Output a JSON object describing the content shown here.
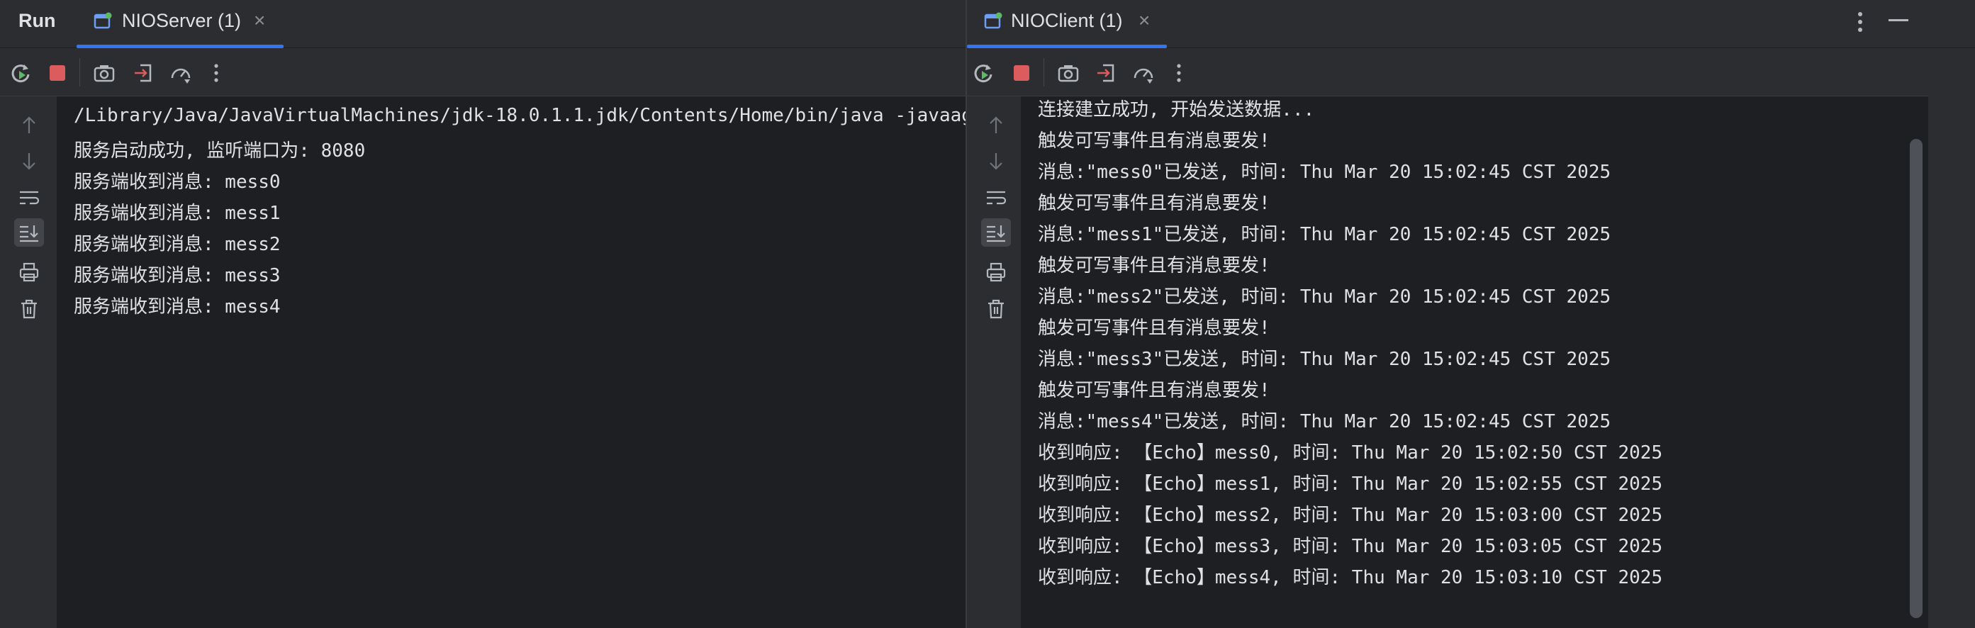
{
  "run_label": "Run",
  "tabs": [
    {
      "title": "NIOServer (1)"
    },
    {
      "title": "NIOClient (1)"
    }
  ],
  "icons": {
    "rerun": "rerun-icon",
    "stop": "stop-icon",
    "screenshot": "camera-icon",
    "exit": "exit-icon",
    "profile": "gauge-icon",
    "more": "more-vertical-icon",
    "up": "arrow-up-icon",
    "down": "arrow-down-icon",
    "wrap": "soft-wrap-icon",
    "scroll_end": "scroll-to-end-icon",
    "print": "print-icon",
    "trash": "trash-icon",
    "minimize": "minimize-icon"
  },
  "server_console": [
    "/Library/Java/JavaVirtualMachines/jdk-18.0.1.1.jdk/Contents/Home/bin/java -javaag",
    "服务启动成功, 监听端口为: 8080",
    "服务端收到消息: mess0",
    "服务端收到消息: mess1",
    "服务端收到消息: mess2",
    "服务端收到消息: mess3",
    "服务端收到消息: mess4"
  ],
  "client_console": [
    "连接建立成功, 开始发送数据...",
    "触发可写事件且有消息要发!",
    "消息:\"mess0\"已发送, 时间: Thu Mar 20 15:02:45 CST 2025",
    "触发可写事件且有消息要发!",
    "消息:\"mess1\"已发送, 时间: Thu Mar 20 15:02:45 CST 2025",
    "触发可写事件且有消息要发!",
    "消息:\"mess2\"已发送, 时间: Thu Mar 20 15:02:45 CST 2025",
    "触发可写事件且有消息要发!",
    "消息:\"mess3\"已发送, 时间: Thu Mar 20 15:02:45 CST 2025",
    "触发可写事件且有消息要发!",
    "消息:\"mess4\"已发送, 时间: Thu Mar 20 15:02:45 CST 2025",
    "收到响应: 【Echo】mess0, 时间: Thu Mar 20 15:02:50 CST 2025",
    "收到响应: 【Echo】mess1, 时间: Thu Mar 20 15:02:55 CST 2025",
    "收到响应: 【Echo】mess2, 时间: Thu Mar 20 15:03:00 CST 2025",
    "收到响应: 【Echo】mess3, 时间: Thu Mar 20 15:03:05 CST 2025",
    "收到响应: 【Echo】mess4, 时间: Thu Mar 20 15:03:10 CST 2025"
  ],
  "colors": {
    "background": "#1e1f22",
    "panel": "#2b2d30",
    "accent": "#3574f0",
    "rerun_green": "#5fb865",
    "stop_red": "#db5c5c",
    "text": "#dfe1e5"
  }
}
